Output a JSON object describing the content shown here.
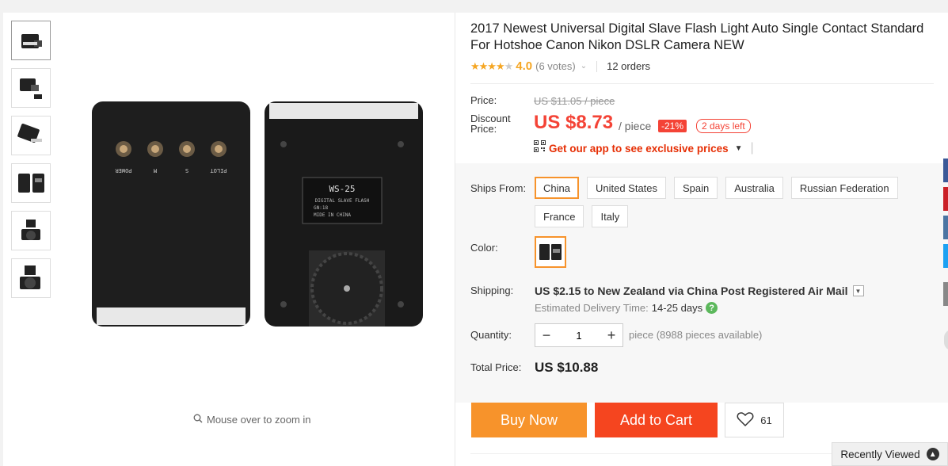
{
  "product": {
    "title": "2017 Newest Universal Digital Slave Flash Light Auto Single Contact Standard For Hotshoe Canon Nikon DSLR Camera NEW",
    "stars_filled": "★★★★",
    "stars_empty": "★",
    "rating_value": "4.0",
    "votes": "(6 votes)",
    "orders": "12 orders"
  },
  "gallery": {
    "zoom_hint": "Mouse over to zoom in",
    "flash_label": "WS-25",
    "flash_sub1": "DIGITAL SLAVE FLASH",
    "flash_sub2": "GN:18",
    "flash_sub3": "MIDE IN CHINA",
    "button_labels": [
      "POWER",
      "M",
      "S",
      "PILOT"
    ]
  },
  "price": {
    "price_label": "Price:",
    "original": "US $11.05 / piece",
    "discount_label": "Discount Price:",
    "discount": "US $8.73",
    "per": "/ piece",
    "off": "-21%",
    "days_left": "2 days left",
    "app_promo": "Get our app to see exclusive prices"
  },
  "ships_from": {
    "label": "Ships From:",
    "options": [
      "China",
      "United States",
      "Spain",
      "Australia",
      "Russian Federation",
      "France",
      "Italy"
    ],
    "selected": "China"
  },
  "color": {
    "label": "Color:"
  },
  "shipping": {
    "label": "Shipping:",
    "text": "US $2.15 to New Zealand via China Post Registered Air Mail",
    "eta_label": "Estimated Delivery Time:",
    "eta_value": "14-25 days"
  },
  "quantity": {
    "label": "Quantity:",
    "value": "1",
    "available": "piece (8988 pieces available)"
  },
  "total": {
    "label": "Total Price:",
    "value": "US $10.88"
  },
  "actions": {
    "buy_now": "Buy Now",
    "add_to_cart": "Add to Cart",
    "wish_count": "61"
  },
  "recently_viewed": "Recently Viewed",
  "colors": {
    "accent_orange": "#f7932b",
    "red": "#f44336",
    "cart_red": "#f5451f"
  }
}
